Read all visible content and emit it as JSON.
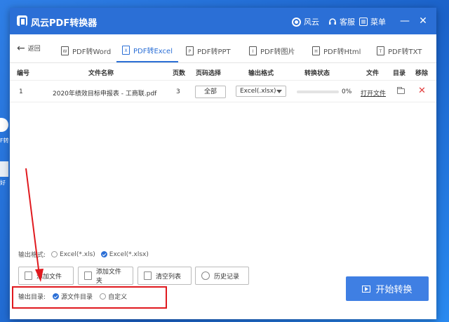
{
  "desktop": {
    "label_1": "F转",
    "label_2": "好"
  },
  "titlebar": {
    "app_title": "风云PDF转换器",
    "user_label": "风云",
    "service_label": "客服",
    "menu_label": "菜单",
    "minimize_glyph": "—",
    "close_glyph": "✕"
  },
  "nav": {
    "back_label": "返回",
    "tabs": [
      {
        "label": "PDF转Word",
        "icon": "W"
      },
      {
        "label": "PDF转Excel",
        "icon": "X"
      },
      {
        "label": "PDF转PPT",
        "icon": "P"
      },
      {
        "label": "PDF转图片",
        "icon": "I"
      },
      {
        "label": "PDF转Html",
        "icon": "H"
      },
      {
        "label": "PDF转TXT",
        "icon": "T"
      }
    ],
    "active_tab": "PDF转Excel"
  },
  "table": {
    "headers": [
      "编号",
      "文件名称",
      "页数",
      "页码选择",
      "输出格式",
      "转换状态",
      "文件",
      "目录",
      "移除"
    ],
    "rows": [
      {
        "index": "1",
        "filename": "2020年绩效目标申报表 - 工商联.pdf",
        "pages": "3",
        "page_select": "全部",
        "format": "Excel(.xlsx)",
        "progress": 0,
        "progress_text": "0%",
        "open_label": "打开文件",
        "remove_glyph": "✕"
      }
    ]
  },
  "format_options": {
    "label": "输出格式:",
    "options": [
      "Excel(*.xls)",
      "Excel(*.xlsx)"
    ],
    "selected": "Excel(*.xlsx)"
  },
  "actions": {
    "add_file": "添加文件",
    "add_folder": "添加文件夹",
    "clear_list": "清空列表",
    "history": "历史记录"
  },
  "output_dir": {
    "label": "输出目录:",
    "options": [
      "源文件目录",
      "自定义"
    ],
    "selected": "源文件目录"
  },
  "start_button": "开始转换",
  "colors": {
    "brand": "#2b6fd6",
    "highlight": "#e0191e",
    "remove": "#e23b3b"
  },
  "icons": [
    "logo-icon",
    "user-icon",
    "headset-icon",
    "menu-icon",
    "back-arrow-icon",
    "file-icon",
    "folder-icon",
    "remove-icon",
    "trash-icon",
    "clock-icon",
    "play-icon"
  ]
}
